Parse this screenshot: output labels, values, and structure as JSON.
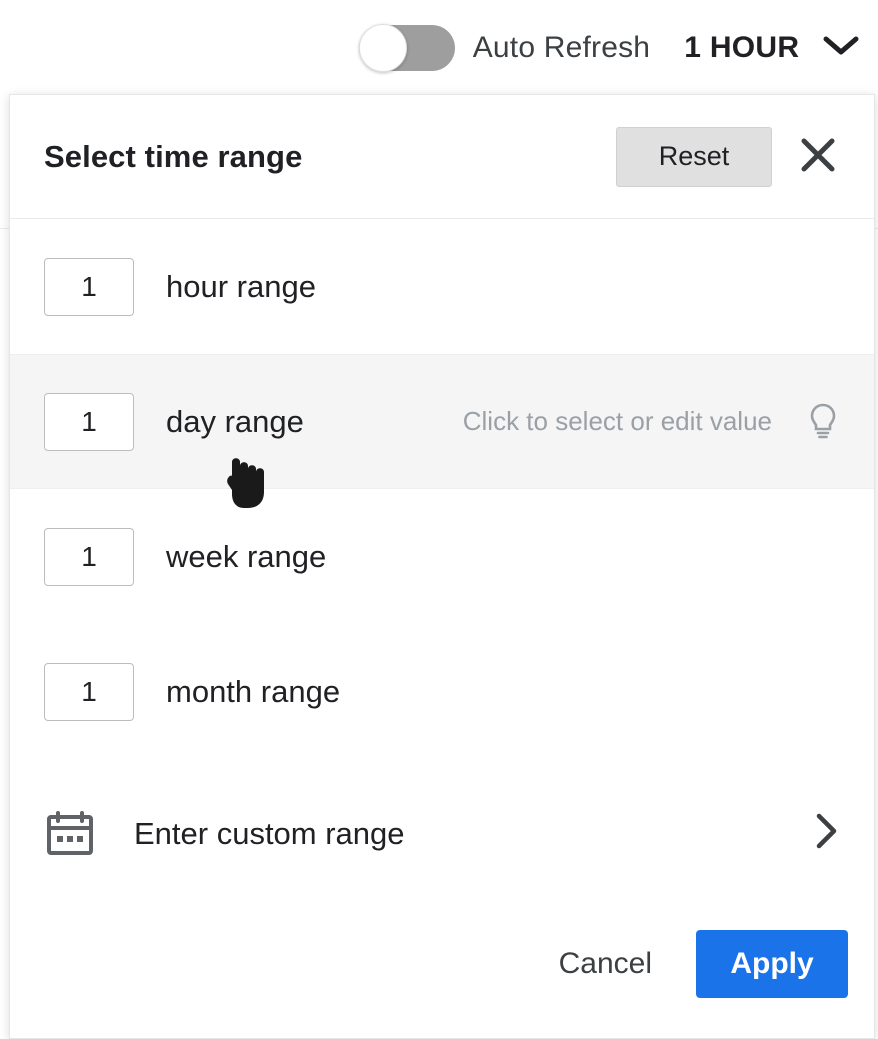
{
  "topbar": {
    "toggle": {
      "name": "auto-refresh-toggle",
      "state": "off"
    },
    "auto_refresh_label": "Auto Refresh",
    "selected_range": "1 HOUR",
    "chevron_icon": "chevron-down-icon"
  },
  "dialog": {
    "title": "Select time range",
    "reset_label": "Reset",
    "close_icon": "close-icon",
    "rows": [
      {
        "value": "1",
        "label": "hour range",
        "hint": "",
        "highlighted": false
      },
      {
        "value": "1",
        "label": "day range",
        "hint": "Click to select or edit value",
        "highlighted": true,
        "bulb_icon": "lightbulb-icon"
      },
      {
        "value": "1",
        "label": "week range",
        "hint": "",
        "highlighted": false
      },
      {
        "value": "1",
        "label": "month range",
        "hint": "",
        "highlighted": false
      }
    ],
    "custom": {
      "icon": "calendar-icon",
      "label": "Enter custom range",
      "chevron_icon": "chevron-right-icon"
    },
    "footer": {
      "cancel_label": "Cancel",
      "apply_label": "Apply"
    }
  },
  "colors": {
    "accent": "#1a73e8",
    "toggle_off": "#9e9e9e",
    "hint_text": "#9aa0a6",
    "highlight_row": "#f5f5f5",
    "reset_button": "#e0e0e0"
  },
  "cursor": {
    "icon": "pointing-hand-cursor"
  }
}
